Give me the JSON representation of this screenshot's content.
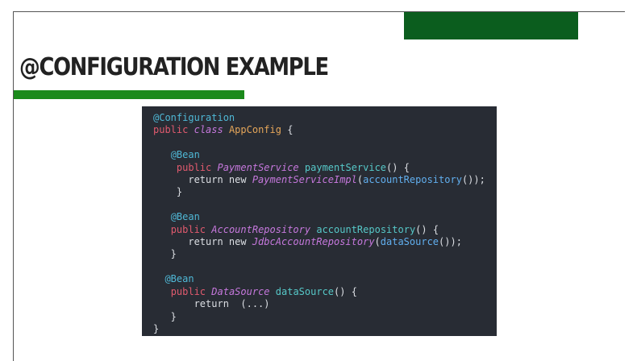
{
  "slide": {
    "title": "@CONFIGURATION EXAMPLE",
    "colors": {
      "top_bar": "#0b5d1e",
      "underline": "#1b8a1b",
      "code_background": "#282c34"
    }
  },
  "code": {
    "language": "java",
    "lines": [
      "@Configuration",
      "public class AppConfig {",
      "",
      "   @Bean",
      "    public PaymentService paymentService() {",
      "      return new PaymentServiceImpl(accountRepository());",
      "    }",
      "",
      "   @Bean",
      "   public AccountRepository accountRepository() {",
      "      return new JdbcAccountRepository(dataSource());",
      "   }",
      "",
      "  @Bean",
      "   public DataSource dataSource() {",
      "       return  (...)",
      "   }",
      "}"
    ]
  }
}
